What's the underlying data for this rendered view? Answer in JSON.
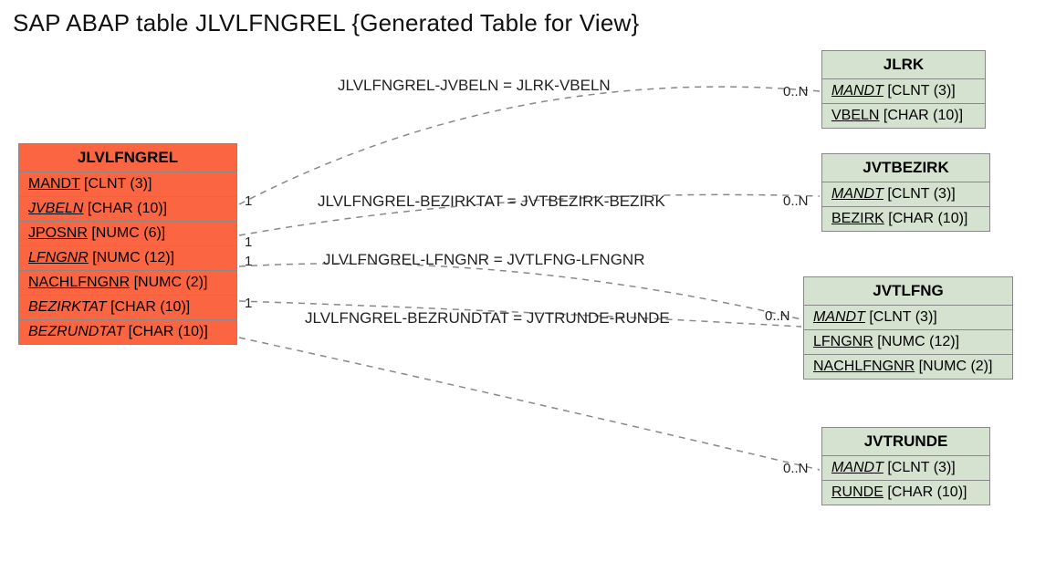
{
  "title": "SAP ABAP table JLVLFNGREL {Generated Table for View}",
  "main": {
    "name": "JLVLFNGREL",
    "fields": [
      {
        "label": "MANDT",
        "type": "[CLNT (3)]",
        "underline": true,
        "italic": false
      },
      {
        "label": "JVBELN",
        "type": "[CHAR (10)]",
        "underline": true,
        "italic": true
      },
      {
        "label": "JPOSNR",
        "type": "[NUMC (6)]",
        "underline": true,
        "italic": false
      },
      {
        "label": "LFNGNR",
        "type": "[NUMC (12)]",
        "underline": true,
        "italic": true
      },
      {
        "label": "NACHLFNGNR",
        "type": "[NUMC (2)]",
        "underline": true,
        "italic": false
      },
      {
        "label": "BEZIRKTAT",
        "type": "[CHAR (10)]",
        "underline": false,
        "italic": true
      },
      {
        "label": "BEZRUNDTAT",
        "type": "[CHAR (10)]",
        "underline": false,
        "italic": true
      }
    ]
  },
  "related": {
    "jlrk": {
      "name": "JLRK",
      "fields": [
        {
          "label": "MANDT",
          "type": "[CLNT (3)]",
          "underline": true,
          "italic": true
        },
        {
          "label": "VBELN",
          "type": "[CHAR (10)]",
          "underline": true,
          "italic": false
        }
      ]
    },
    "jvtbezirk": {
      "name": "JVTBEZIRK",
      "fields": [
        {
          "label": "MANDT",
          "type": "[CLNT (3)]",
          "underline": true,
          "italic": true
        },
        {
          "label": "BEZIRK",
          "type": "[CHAR (10)]",
          "underline": true,
          "italic": false
        }
      ]
    },
    "jvtlfng": {
      "name": "JVTLFNG",
      "fields": [
        {
          "label": "MANDT",
          "type": "[CLNT (3)]",
          "underline": true,
          "italic": true
        },
        {
          "label": "LFNGNR",
          "type": "[NUMC (12)]",
          "underline": true,
          "italic": false
        },
        {
          "label": "NACHLFNGNR",
          "type": "[NUMC (2)]",
          "underline": true,
          "italic": false
        }
      ]
    },
    "jvtrunde": {
      "name": "JVTRUNDE",
      "fields": [
        {
          "label": "MANDT",
          "type": "[CLNT (3)]",
          "underline": true,
          "italic": true
        },
        {
          "label": "RUNDE",
          "type": "[CHAR (10)]",
          "underline": true,
          "italic": false
        }
      ]
    }
  },
  "edges": {
    "e1": {
      "label": "JLVLFNGREL-JVBELN = JLRK-VBELN",
      "left": "1",
      "right": "0..N"
    },
    "e2": {
      "label": "JLVLFNGREL-BEZIRKTAT = JVTBEZIRK-BEZIRK",
      "left": "1",
      "right": "0..N"
    },
    "e3": {
      "label": "JLVLFNGREL-LFNGNR = JVTLFNG-LFNGNR",
      "left": "1",
      "right": ""
    },
    "e4": {
      "label": "JLVLFNGREL-BEZRUNDTAT = JVTRUNDE-RUNDE",
      "left": "1",
      "right": "0..N"
    },
    "e5": {
      "right": "0..N"
    }
  }
}
